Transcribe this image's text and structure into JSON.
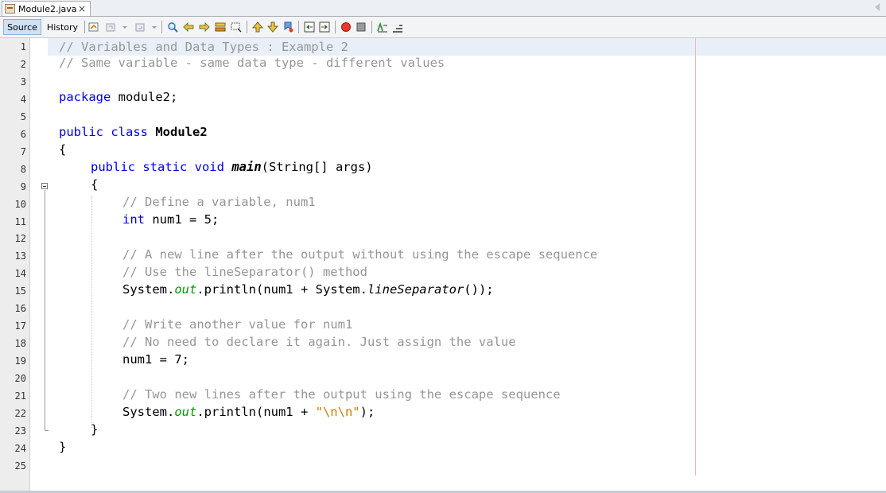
{
  "tab": {
    "title": "Module2.java",
    "close": "×"
  },
  "toolbar": {
    "source_label": "Source",
    "history_label": "History"
  },
  "colors": {
    "keyword": "#0000e6",
    "comment": "#969696",
    "string": "#ce7b00",
    "field": "#009900"
  },
  "editor": {
    "line_numbers": [
      "1",
      "2",
      "3",
      "4",
      "5",
      "6",
      "7",
      "8",
      "9",
      "10",
      "11",
      "12",
      "13",
      "14",
      "15",
      "16",
      "17",
      "18",
      "19",
      "20",
      "21",
      "22",
      "23",
      "24",
      "25"
    ],
    "code": {
      "l1": "// Variables and Data Types : Example 2",
      "l2": "// Same variable - same data type - different values",
      "l4_kw": "package",
      "l4_rest": " module2;",
      "l6_kw": "public class",
      "l6_name": "Module2",
      "l7": "{",
      "l8_kw": "public static void",
      "l8_name": "main",
      "l8_rest": "(String[] args)",
      "l9": "{",
      "l10": "// Define a variable, num1",
      "l11_kw": "int",
      "l11_rest": " num1 = 5;",
      "l13": "// A new line after the output without using the escape sequence",
      "l14": "// Use the lineSeparator() method",
      "l15_a": "System.",
      "l15_out": "out",
      "l15_b": ".println(num1 + System.",
      "l15_ls": "lineSeparator",
      "l15_c": "());",
      "l17": "// Write another value for num1",
      "l18": "// No need to declare it again. Just assign the value",
      "l19": "num1 = 7;",
      "l21": "// Two new lines after the output using the escape sequence",
      "l22_a": "System.",
      "l22_out": "out",
      "l22_b": ".println(num1 + ",
      "l22_str": "\"\\n\\n\"",
      "l22_c": ");",
      "l23": "}",
      "l24": "}"
    }
  }
}
